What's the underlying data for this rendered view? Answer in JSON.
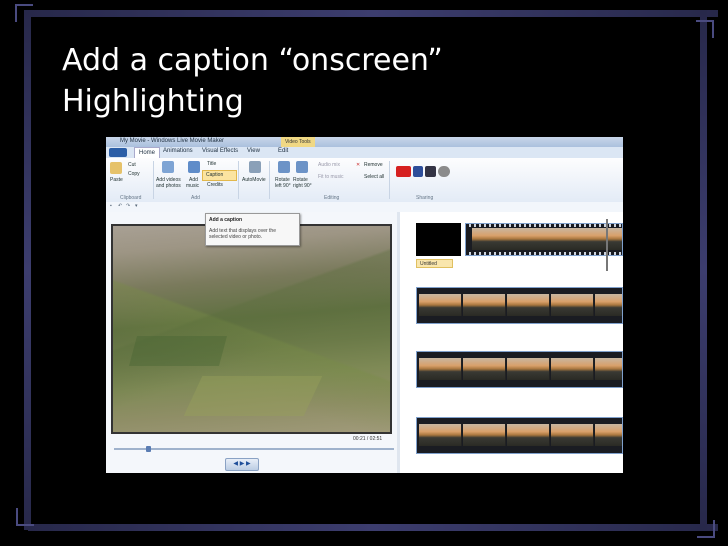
{
  "slide": {
    "title_line1": "Add a caption “onscreen”",
    "title_line2": "Highlighting"
  },
  "app": {
    "window_title": "My Movie - Windows Live Movie Maker",
    "contextual_tab": "Video Tools",
    "tabs": [
      "Home",
      "Animations",
      "Visual Effects",
      "View",
      "Edit"
    ],
    "active_tab": "Home"
  },
  "ribbon": {
    "paste": "Paste",
    "cut": "Cut",
    "copy": "Copy",
    "add_videos": "Add videos",
    "add_photos": "and photos",
    "add_music_1": "Add",
    "add_music_2": "music",
    "title": "Title",
    "caption": "Caption",
    "credits": "Credits",
    "automovie": "AutoMovie",
    "rotate_left_1": "Rotate",
    "rotate_left_2": "left 90°",
    "rotate_right_1": "Rotate",
    "rotate_right_2": "right 90°",
    "audio_mix": "Audio mix",
    "fit_to_music": "Fit to music",
    "remove": "Remove",
    "select_all": "Select all",
    "groups": {
      "clipboard": "Clipboard",
      "add": "Add",
      "editing": "Editing",
      "sharing": "Sharing"
    }
  },
  "tooltip": {
    "heading": "Add a caption",
    "body": "Add text that displays over the selected video or photo."
  },
  "player": {
    "timecode": "00:21 / 02:51"
  },
  "storyboard": {
    "caption_tag": "Untitled"
  },
  "colors": {
    "slide_background": "#000000",
    "frame_bars": "#3c3d6e",
    "title_text": "#ffffff",
    "caption_highlight": "#fbe4a0"
  }
}
